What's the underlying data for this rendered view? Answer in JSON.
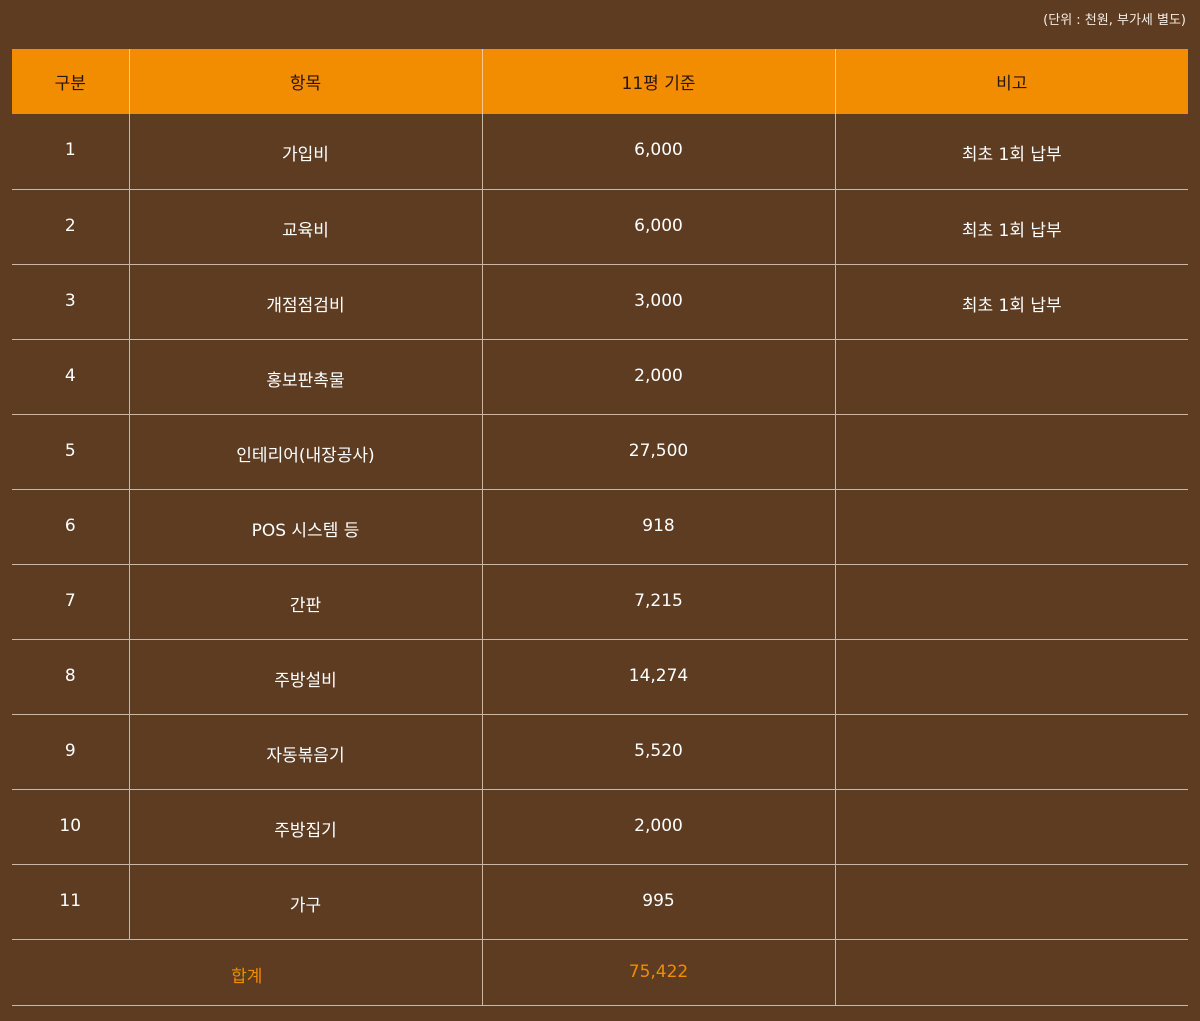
{
  "unit_note": "(단위 : 천원, 부가세 별도)",
  "table": {
    "headers": [
      "구분",
      "항목",
      "11평 기준",
      "비고"
    ],
    "rows": [
      {
        "no": "1",
        "item": "가입비",
        "amount": "6,000",
        "note": "최초 1회 납부"
      },
      {
        "no": "2",
        "item": "교육비",
        "amount": "6,000",
        "note": "최초 1회 납부"
      },
      {
        "no": "3",
        "item": "개점점검비",
        "amount": "3,000",
        "note": "최초 1회 납부"
      },
      {
        "no": "4",
        "item": "홍보판촉물",
        "amount": "2,000",
        "note": ""
      },
      {
        "no": "5",
        "item": "인테리어(내장공사)",
        "amount": "27,500",
        "note": ""
      },
      {
        "no": "6",
        "item": "POS 시스템 등",
        "amount": "918",
        "note": ""
      },
      {
        "no": "7",
        "item": "간판",
        "amount": "7,215",
        "note": ""
      },
      {
        "no": "8",
        "item": "주방설비",
        "amount": "14,274",
        "note": ""
      },
      {
        "no": "9",
        "item": "자동볶음기",
        "amount": "5,520",
        "note": ""
      },
      {
        "no": "10",
        "item": "주방집기",
        "amount": "2,000",
        "note": ""
      },
      {
        "no": "11",
        "item": "가구",
        "amount": "995",
        "note": ""
      }
    ],
    "total": {
      "label": "합계",
      "amount": "75,422",
      "note": ""
    }
  }
}
